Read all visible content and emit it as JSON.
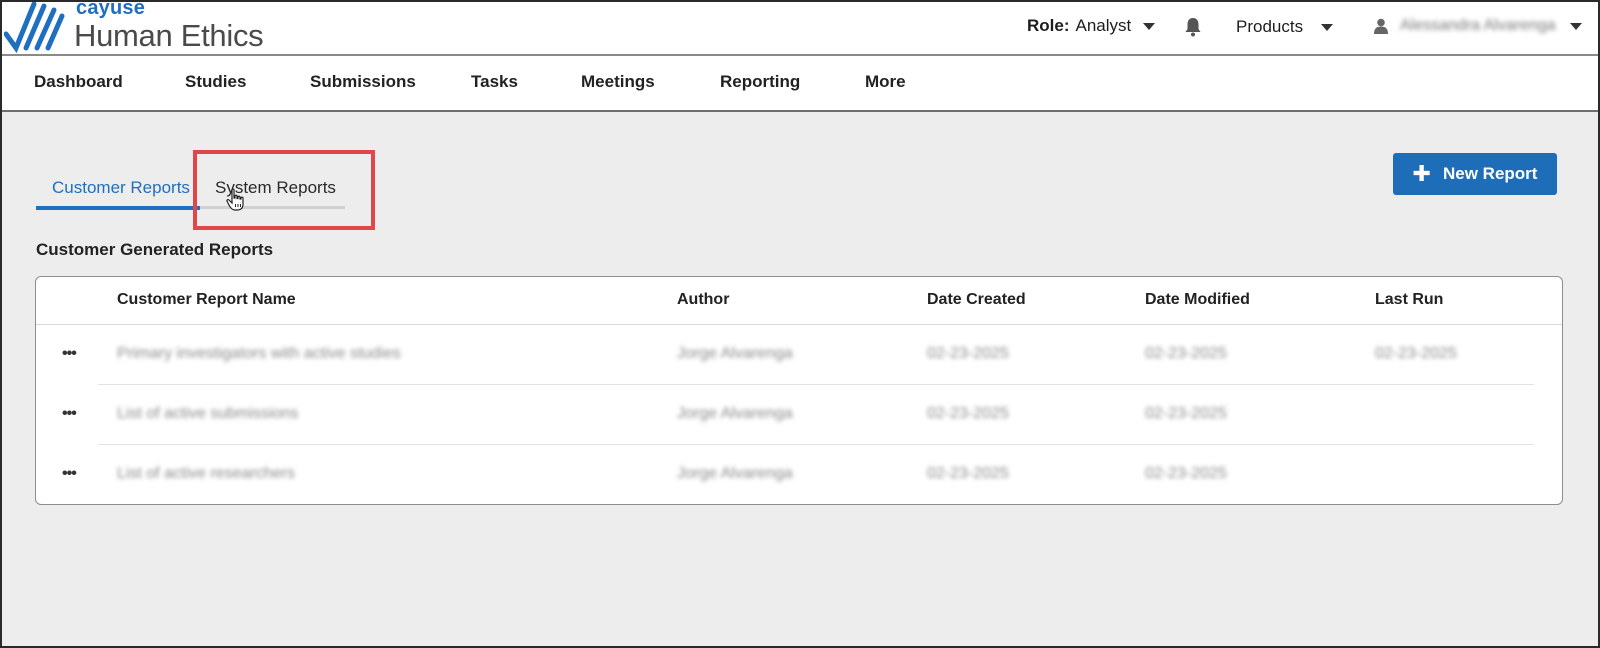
{
  "header": {
    "brand": "cayuse",
    "product": "Human Ethics",
    "role_label": "Role:",
    "role_value": "Analyst",
    "products_label": "Products",
    "user_name": "Alessandra Alvarenga"
  },
  "nav": {
    "items": [
      "Dashboard",
      "Studies",
      "Submissions",
      "Tasks",
      "Meetings",
      "Reporting",
      "More"
    ]
  },
  "tabs": {
    "customer": "Customer Reports",
    "system": "System Reports"
  },
  "actions": {
    "new_report": "New Report"
  },
  "section": {
    "title": "Customer Generated Reports"
  },
  "table": {
    "columns": [
      "Customer Report Name",
      "Author",
      "Date Created",
      "Date Modified",
      "Last Run"
    ],
    "rows": [
      {
        "menu": "•••",
        "name": "Primary investigators with active studies",
        "author": "Jorge Alvarenga",
        "created": "02-23-2025",
        "modified": "02-23-2025",
        "last_run": "02-23-2025"
      },
      {
        "menu": "•••",
        "name": "List of active submissions",
        "author": "Jorge Alvarenga",
        "created": "02-23-2025",
        "modified": "02-23-2025",
        "last_run": ""
      },
      {
        "menu": "•••",
        "name": "List of active researchers",
        "author": "Jorge Alvarenga",
        "created": "02-23-2025",
        "modified": "02-23-2025",
        "last_run": ""
      }
    ]
  },
  "colors": {
    "accent": "#1f6fc1",
    "button": "#1d6db8",
    "highlight": "#e0474b",
    "background": "#ecedec"
  },
  "icons": {
    "logo": "cayuse-checkmark-logo",
    "bell": "bell-icon",
    "user": "user-icon",
    "caret": "caret-down-icon",
    "plus": "plus-icon",
    "cursor": "hand-pointer-icon"
  }
}
